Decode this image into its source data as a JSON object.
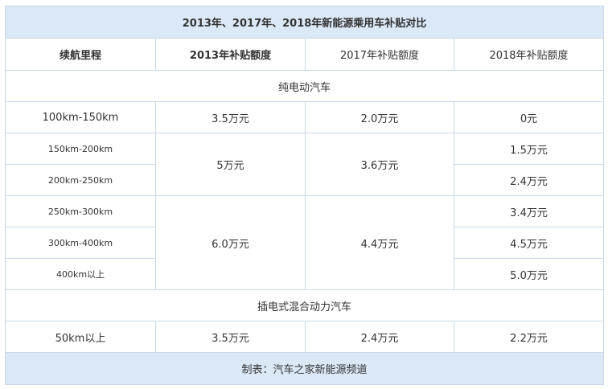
{
  "table": {
    "title": "2013年、2017年、2018年新能源乘用车补贴对比",
    "headers": [
      "续航里程",
      "2013年补贴额度",
      "2017年补贴额度",
      "2018年补贴额度"
    ],
    "sections": {
      "electric": "纯电动汽车",
      "plugin_hybrid": "插电式混合动力汽车"
    },
    "rows": {
      "r1": {
        "range": "100km-150km",
        "y2013": "3.5万元",
        "y2017": "2.0万元",
        "y2018": "0元"
      },
      "r2": {
        "range": "150km-200km",
        "y2018": "1.5万元"
      },
      "r3": {
        "range": "200km-250km",
        "y2018": "2.4万元"
      },
      "r23_shared": {
        "y2013": "5万元",
        "y2017": "3.6万元"
      },
      "r4": {
        "range": "250km-300km",
        "y2018": "3.4万元"
      },
      "r5": {
        "range": "300km-400km",
        "y2018": "4.5万元"
      },
      "r6": {
        "range": "400km以上",
        "y2018": "5.0万元"
      },
      "r456_shared": {
        "y2013": "6.0万元",
        "y2017": "4.4万元"
      },
      "r7": {
        "range": "50km以上",
        "y2013": "3.5万元",
        "y2017": "2.4万元",
        "y2018": "2.2万元"
      }
    },
    "footer": "制表：汽车之家新能源频道"
  }
}
